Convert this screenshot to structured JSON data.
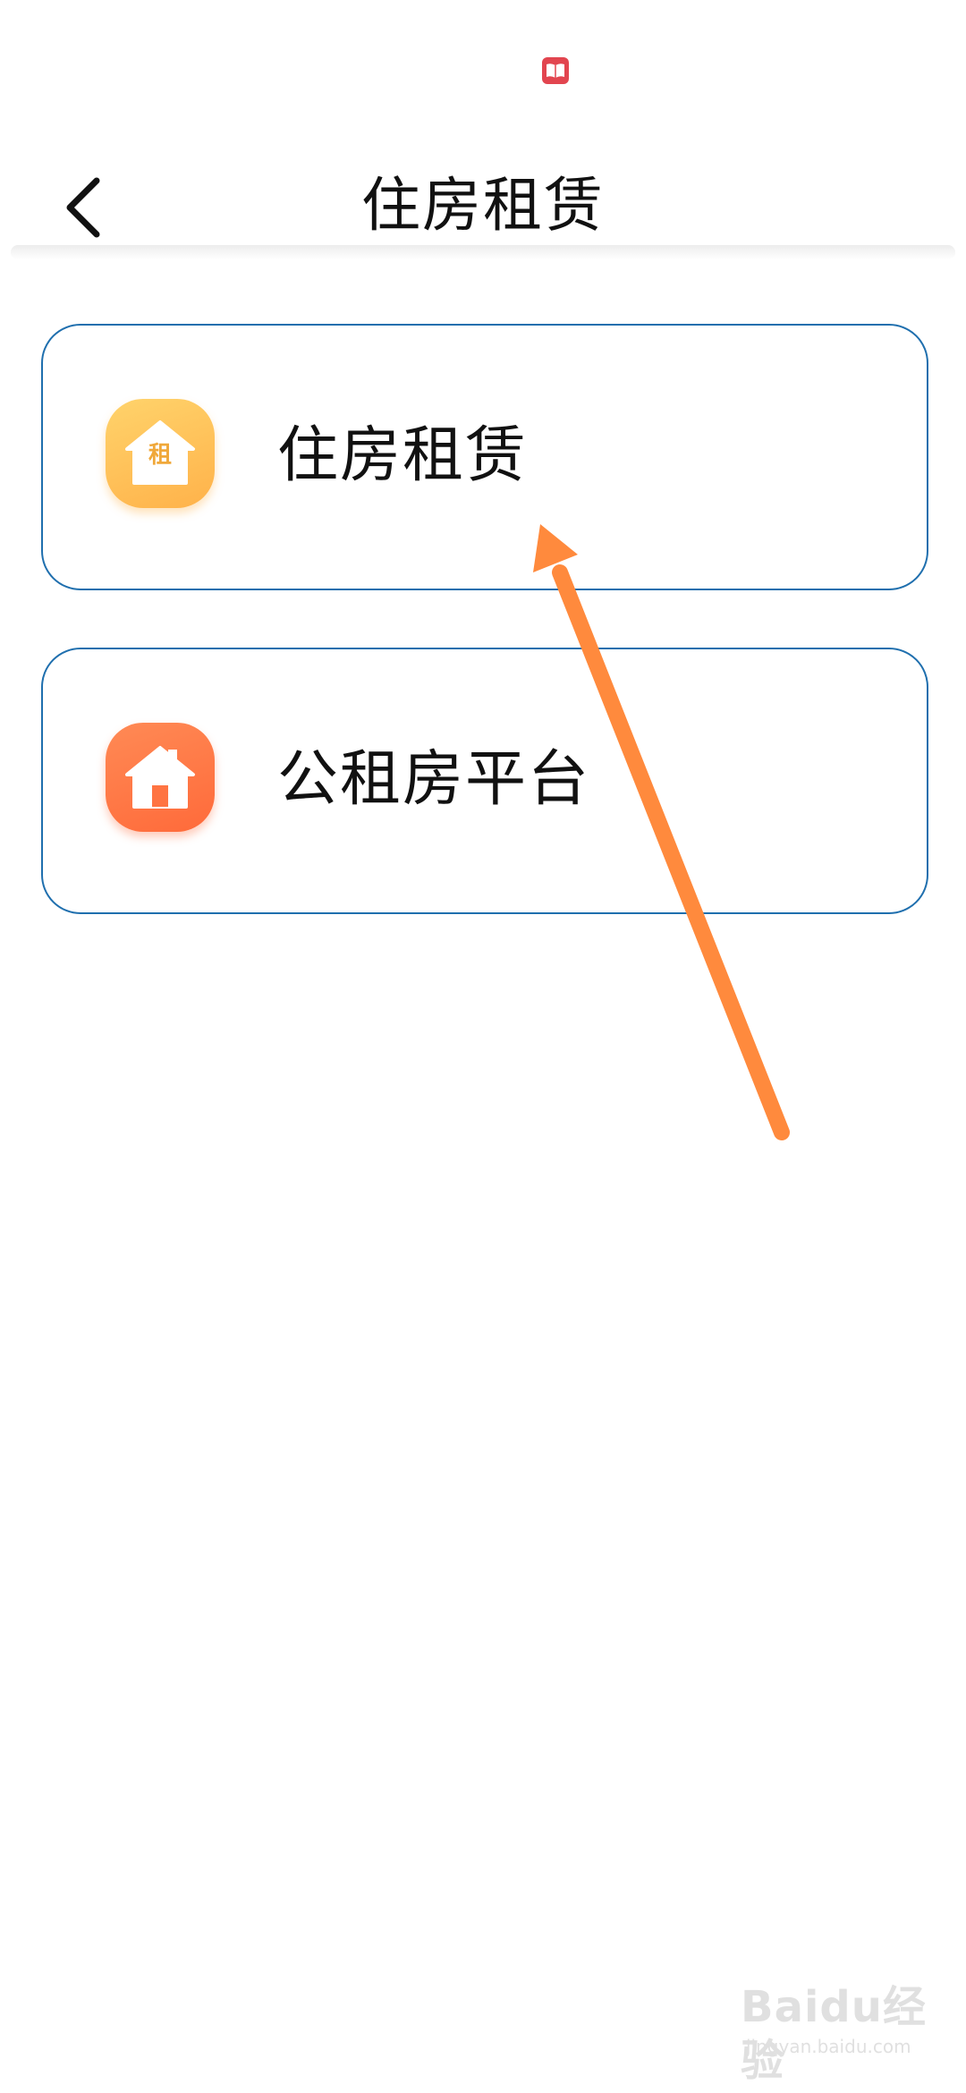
{
  "status_bar": {
    "icons": [
      "book-icon"
    ],
    "accent": "#e2454f"
  },
  "header": {
    "title": "住房租赁",
    "back_icon": "chevron-left-icon"
  },
  "cards": [
    {
      "label": "住房租赁",
      "icon": "house-rent-icon",
      "icon_badge": "租",
      "icon_color": "#ffb84d"
    },
    {
      "label": "公租房平台",
      "icon": "house-icon",
      "icon_color": "#ff7442"
    }
  ],
  "annotation": {
    "type": "arrow",
    "color": "#ff8a3d",
    "points_to": "cards.0"
  },
  "watermark": {
    "text": "Baidu经验",
    "url": "jingyan.baidu.com"
  },
  "colors": {
    "card_border": "#1f6fae",
    "background": "#ffffff",
    "text": "#111111"
  }
}
